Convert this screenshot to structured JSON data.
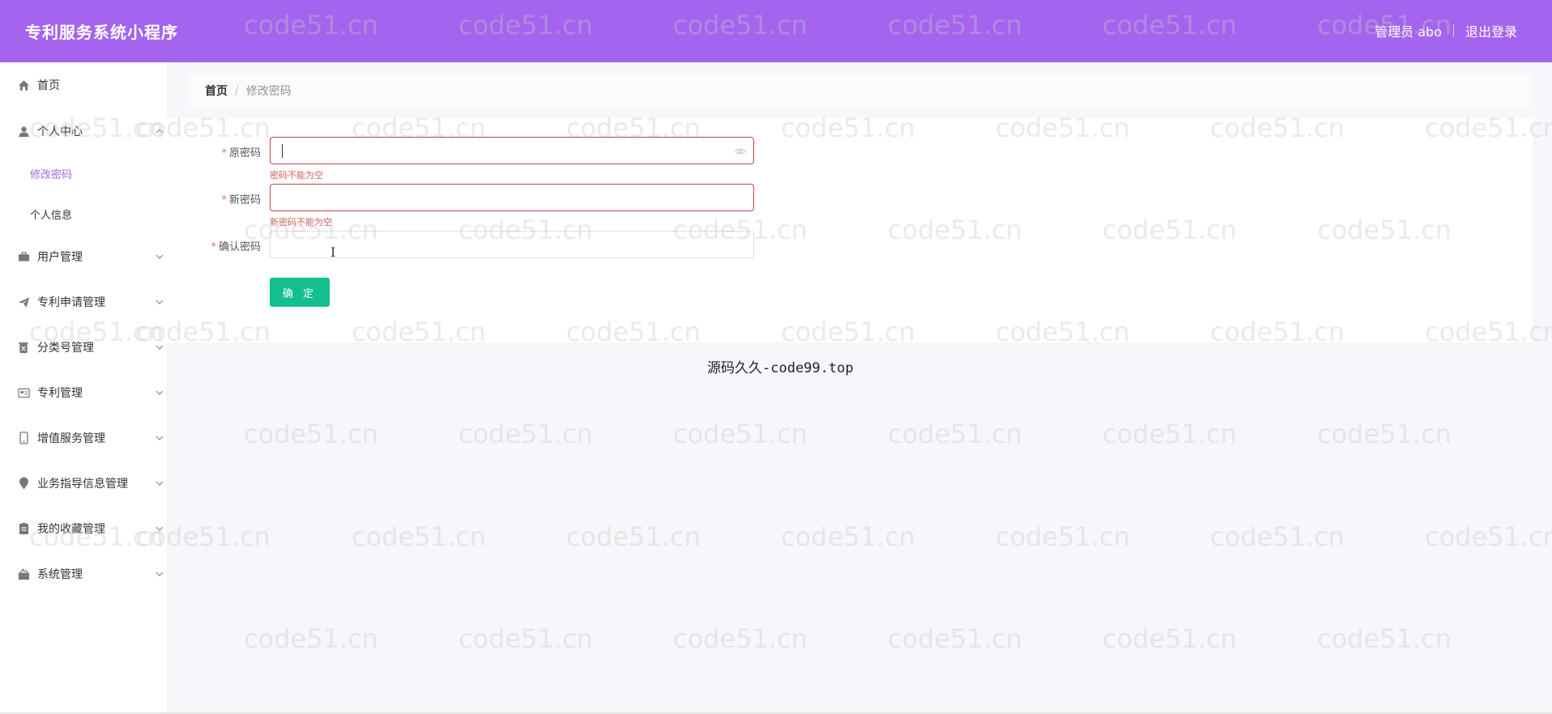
{
  "header": {
    "app_title": "专利服务系统小程序",
    "user_label": "管理员 abo",
    "logout_label": "退出登录",
    "background_color": "#a464ee"
  },
  "sidebar": {
    "items": [
      {
        "label": "首页",
        "icon": "home-icon",
        "expandable": false
      },
      {
        "label": "个人中心",
        "icon": "user-icon",
        "expandable": true,
        "expanded": true,
        "children": [
          {
            "label": "修改密码",
            "active": true
          },
          {
            "label": "个人信息",
            "active": false
          }
        ]
      },
      {
        "label": "用户管理",
        "icon": "briefcase-icon",
        "expandable": true
      },
      {
        "label": "专利申请管理",
        "icon": "paper-plane-icon",
        "expandable": true
      },
      {
        "label": "分类号管理",
        "icon": "trash-box-icon",
        "expandable": true
      },
      {
        "label": "专利管理",
        "icon": "id-card-icon",
        "expandable": true
      },
      {
        "label": "增值服务管理",
        "icon": "phone-icon",
        "expandable": true
      },
      {
        "label": "业务指导信息管理",
        "icon": "location-pin-icon",
        "expandable": true
      },
      {
        "label": "我的收藏管理",
        "icon": "clipboard-icon",
        "expandable": true
      },
      {
        "label": "系统管理",
        "icon": "gift-icon",
        "expandable": true
      }
    ],
    "active_color": "#a464ee"
  },
  "breadcrumb": {
    "home": "首页",
    "separator": "/",
    "current": "修改密码"
  },
  "form": {
    "fields": [
      {
        "label": "原密码",
        "required": true,
        "value": "",
        "error": "密码不能为空",
        "has_eye_toggle": true,
        "focused": true
      },
      {
        "label": "新密码",
        "required": true,
        "value": "",
        "error": "新密码不能为空"
      },
      {
        "label": "确认密码",
        "required": true,
        "value": "",
        "error": ""
      }
    ],
    "submit_label": "确 定",
    "submit_color": "#13bf8f",
    "error_color": "#d0605d"
  },
  "caption": "源码久久-code99.top",
  "watermark": "code51.cn"
}
